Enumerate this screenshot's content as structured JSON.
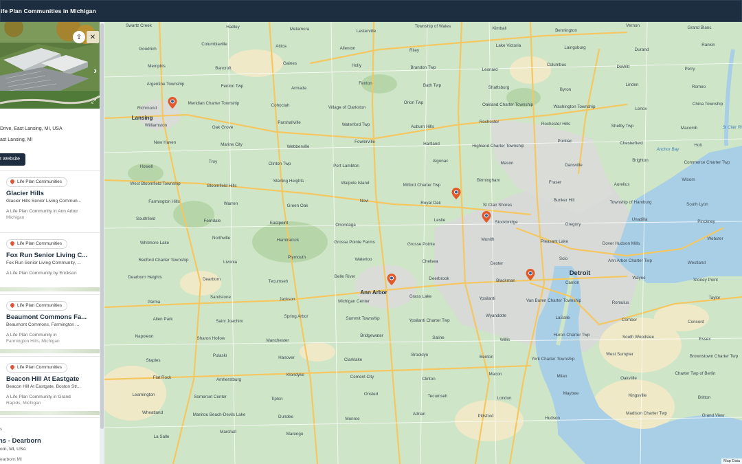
{
  "header": {
    "title": "ife Plan Communities in Michigan"
  },
  "featured": {
    "address_line1": "Drive, East Lansing, MI, USA",
    "address_line2": "ast Lansing, MI",
    "visit_label": "t Website"
  },
  "cards": [
    {
      "tag": "Life Plan Communities",
      "name": "Glacier Hills",
      "sub": "Glacier Hills Senior Living Commun...",
      "desc1": "A Life Plan Community in Ann Arbor",
      "desc2": "Michigan"
    },
    {
      "tag": "Life Plan Communities",
      "name": "Fox Run Senior Living C...",
      "sub": "Fox Run Senior Living Community, ...",
      "desc1": "A Life Plan Community by Erickson",
      "desc2": ""
    },
    {
      "tag": "Life Plan Communities",
      "name": "Beaumont Commons Fa...",
      "sub": "Beaumont Commons, Farmington ...",
      "desc1": "A Life Plan Community in",
      "desc2": "Farmington Hills, Michigan"
    },
    {
      "tag": "Life Plan Communities",
      "name": "Beacon Hill At Eastgate",
      "sub": "Beacon Hill At Eastgate, Boston Str...",
      "desc1": "A Life Plan Community in Grand",
      "desc2": "Rapids, Michigan"
    }
  ],
  "last_card": {
    "tag": "s",
    "name": "ns - Dearborn",
    "sub": "orn, MI, USA",
    "desc": "earborn MI"
  },
  "map": {
    "attribution": "Map Data",
    "big_labels": [
      "Detroit",
      "Ann Arbor",
      "Lansing"
    ],
    "labels": [
      "Swartz Creek",
      "Hadley",
      "Metamora",
      "Lesterville",
      "Township of Wales",
      "Kimball",
      "Bennington",
      "Vernon",
      "Grand Blanc",
      "Goodrich",
      "Columbiaville",
      "Attica",
      "Allenton",
      "Riley",
      "Lake Victoria",
      "Laingsburg",
      "Durand",
      "Rankin",
      "Memphis",
      "Bancroft",
      "Gaines",
      "Holly",
      "Brandon Twp",
      "Leonard",
      "Columbus",
      "DeWitt",
      "Perry",
      "Argentine Township",
      "Fenton Twp",
      "Armada",
      "Fenton",
      "Bath Twp",
      "Shaftsburg",
      "Byron",
      "Linden",
      "Romeo",
      "Richmond",
      "Meridian Charter Township",
      "Cohoctah",
      "Village of Clarkston",
      "Orion Twp",
      "Oakland Charter Township",
      "Washington Township",
      "Lenox",
      "China Township",
      "Williamston",
      "Oak Grove",
      "Parshallville",
      "Waterford Twp",
      "Auburn Hills",
      "Rochester",
      "Rochester Hills",
      "Shelby Twp",
      "Macomb",
      "New Haven",
      "Marine City",
      "Webberville",
      "Fowlerville",
      "Hartland",
      "Highland Charter Township",
      "Pontiac",
      "Chesterfield",
      "Holt",
      "Howell",
      "Troy",
      "Clinton Twp",
      "Port Lambton",
      "Algonac",
      "Mason",
      "Dansville",
      "Brighton",
      "Commerce Charter Twp",
      "West Bloomfield Township",
      "Bloomfield Hills",
      "Sterling Heights",
      "Walpole Island",
      "Milford Charter Twp",
      "Birmingham",
      "Fraser",
      "Aurelius",
      "Wixom",
      "Farmington Hills",
      "Warren",
      "Green Oak",
      "Novi",
      "Royal Oak",
      "St Clair Shores",
      "Bunker Hill",
      "Township of Hamburg",
      "South Lyon",
      "Southfield",
      "Ferndale",
      "Eastpoint",
      "Onondaga",
      "Leslie",
      "Stockbridge",
      "Gregory",
      "Unadilla",
      "Pinckney",
      "Whitmore Lake",
      "Northville",
      "Hamtramck",
      "Grosse Pointe Farms",
      "Grosse Pointe",
      "Munith",
      "Pleasant Lake",
      "Dover Hudson Mills",
      "Webster",
      "Redford Charter Township",
      "Livonia",
      "Plymouth",
      "Waterloo",
      "Chelsea",
      "Dexter",
      "Scio",
      "Ann Arbor Charter Twp",
      "Westland",
      "Dearborn Heights",
      "Dearborn",
      "Tecumseh",
      "Belle River",
      "Deerbrook",
      "Blackman",
      "Canton",
      "Wayne",
      "Stoney Point",
      "Parma",
      "Sandstone",
      "Jackson",
      "Michigan Center",
      "Grass Lake",
      "Ypsilanti",
      "Van Buren Charter Township",
      "Romulus",
      "Taylor",
      "Allen Park",
      "Saint Joachim",
      "Spring Arbor",
      "Summit Township",
      "Ypsilanti Charter Twp",
      "Wyandotte",
      "LaSalle",
      "Comber",
      "Concord",
      "Napoleon",
      "Sharon Hollow",
      "Manchester",
      "Bridgewater",
      "Saline",
      "Willis",
      "Huron Charter Twp",
      "South Woodslee",
      "Essex",
      "Staples",
      "Pulaski",
      "Hanover",
      "Clarklake",
      "Brooklyn",
      "Benton",
      "York Charter Township",
      "West Sumpter",
      "Brownstown Charter Twp",
      "Flat Rock",
      "Amherstburg",
      "Klondyke",
      "Cement City",
      "Clinton",
      "Macon",
      "Milan",
      "Oakvillle",
      "Charter Twp of Berlin",
      "Leamington",
      "Somerset Center",
      "Tipton",
      "Onsted",
      "Tecumseh",
      "London",
      "Maybee",
      "Kingsville",
      "Britton",
      "Wheatland",
      "Manitou Beach-Devils Lake",
      "Dundee",
      "Monroe",
      "Adrian",
      "Pittsford",
      "Hudson",
      "Madison Charter Twp",
      "Grand View",
      "La Salle",
      "Marshall",
      "Marengo"
    ],
    "water_labels": [
      "Anchor Bay",
      "St Clair River"
    ]
  }
}
